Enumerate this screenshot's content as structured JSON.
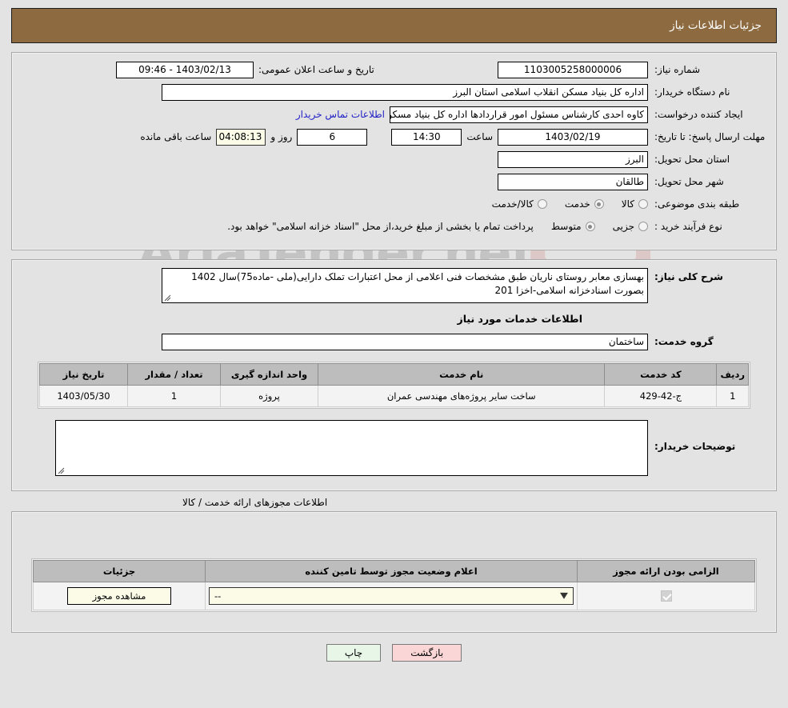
{
  "header": {
    "title": "جزئیات اطلاعات نیاز"
  },
  "watermark": {
    "text": "AriaTender.net"
  },
  "info": {
    "need_number_label": "شماره نیاز:",
    "need_number_value": "1103005258000006",
    "announce_datetime_label": "تاریخ و ساعت اعلان عمومی:",
    "announce_datetime_value": "1403/02/13 - 09:46",
    "buyer_org_label": "نام دستگاه خریدار:",
    "buyer_org_value": "اداره کل بنیاد مسکن انقلاب اسلامی استان البرز",
    "creator_label": "ایجاد کننده درخواست:",
    "creator_value": "کاوه احدی کارشناس مسئول امور قراردادها اداره کل بنیاد مسکن انقلاب اسلامی",
    "contact_link": "اطلاعات تماس خریدار",
    "deadline_label": "مهلت ارسال پاسخ: تا تاریخ:",
    "deadline_date": "1403/02/19",
    "deadline_hour_label": "ساعت",
    "deadline_hour_value": "14:30",
    "remaining_days_value": "6",
    "remaining_days_label": "روز و",
    "remaining_time_value": "04:08:13",
    "remaining_time_label": "ساعت باقی مانده",
    "province_label": "استان محل تحویل:",
    "province_value": "البرز",
    "city_label": "شهر محل تحویل:",
    "city_value": "طالقان",
    "category_label": "طبقه بندی موضوعی:",
    "category_options": [
      {
        "label": "کالا",
        "selected": false
      },
      {
        "label": "خدمت",
        "selected": true
      },
      {
        "label": "کالا/خدمت",
        "selected": false
      }
    ],
    "process_label": "نوع فرآیند خرید :",
    "process_options": [
      {
        "label": "جزیی",
        "selected": false
      },
      {
        "label": "متوسط",
        "selected": true
      }
    ],
    "process_note": "پرداخت تمام یا بخشی از مبلغ خرید،از محل \"اسناد خزانه اسلامی\" خواهد بود."
  },
  "description": {
    "label": "شرح کلی نیاز:",
    "value": "بهسازی معابر روستای ناریان طبق مشخصات فنی اعلامی از محل اعتبارات تملک دارایی(ملی -ماده75)سال 1402 بصورت اسنادخزانه اسلامی-اخزا 201"
  },
  "services": {
    "section_title": "اطلاعات خدمات مورد نیاز",
    "service_group_label": "گروه خدمت:",
    "service_group_value": "ساختمان",
    "table": {
      "columns": [
        "ردیف",
        "کد خدمت",
        "نام خدمت",
        "واحد اندازه گیری",
        "تعداد / مقدار",
        "تاریخ نیاز"
      ],
      "rows": [
        {
          "row_no": "1",
          "service_code": "ج-42-429",
          "service_name": "ساخت سایر پروژه‌های مهندسی عمران",
          "unit": "پروژه",
          "quantity": "1",
          "need_date": "1403/05/30"
        }
      ]
    }
  },
  "buyer_notes": {
    "label": "توضیحات خریدار:",
    "value": ""
  },
  "licenses": {
    "caption": "اطلاعات مجوزهای ارائه خدمت / کالا",
    "columns": [
      "الزامی بودن ارائه مجوز",
      "اعلام وضعیت مجوز توسط تامین کننده",
      "جزئیات"
    ],
    "rows": [
      {
        "required_checked": true,
        "status_value": "--",
        "details_button": "مشاهده مجوز"
      }
    ]
  },
  "footer": {
    "print_label": "چاپ",
    "back_label": "بازگشت"
  }
}
